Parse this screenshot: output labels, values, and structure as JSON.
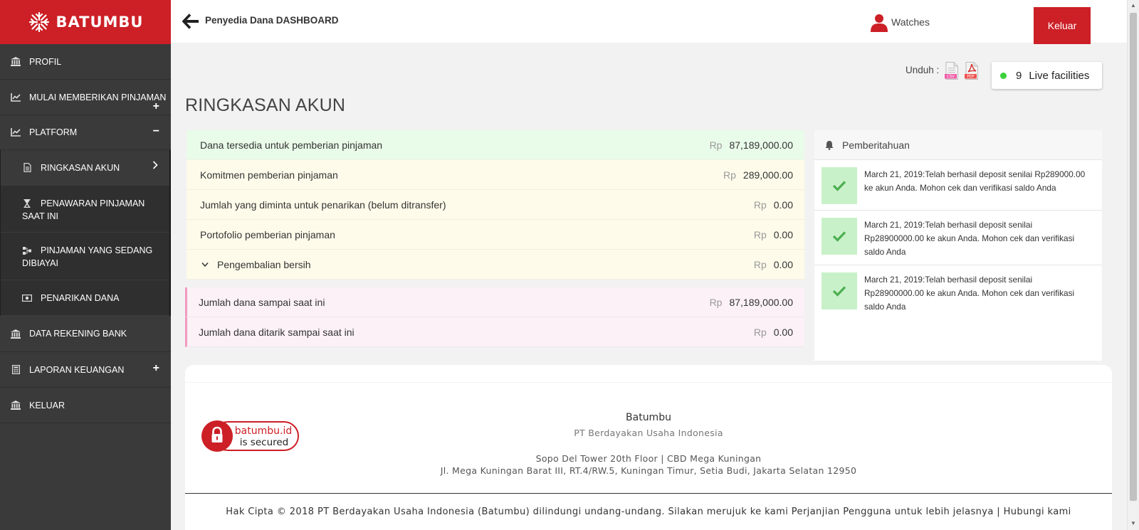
{
  "brand": {
    "name": "BATUMBU"
  },
  "sidebar": {
    "items": [
      {
        "label": "PROFIL",
        "icon": "bank-icon"
      },
      {
        "label": "MULAI MEMBERIKAN PINJAMAN",
        "icon": "chart-line-icon",
        "control": "+"
      },
      {
        "label": "PLATFORM",
        "icon": "chart-line-icon",
        "control": "−"
      },
      {
        "label": "DATA REKENING BANK",
        "icon": "bank-icon"
      },
      {
        "label": "LAPORAN KEUANGAN",
        "icon": "calculator-icon",
        "control": "+"
      },
      {
        "label": "KELUAR",
        "icon": "bank-icon"
      }
    ],
    "platform_sub": [
      {
        "label": "RINGKASAN AKUN",
        "icon": "document-icon",
        "active": true
      },
      {
        "label": "PENAWARAN PINJAMAN SAAT INI",
        "icon": "hourglass-icon"
      },
      {
        "label": "PINJAMAN YANG SEDANG DIBIAYAI",
        "icon": "sitemap-icon"
      },
      {
        "label": "PENARIKAN DANA",
        "icon": "money-icon"
      }
    ]
  },
  "header": {
    "title": "Penyedia Dana DASHBOARD",
    "user": "Watches",
    "logout_label": "Keluar"
  },
  "toolbar": {
    "download_label": "Unduh :",
    "csv_label": "CSV",
    "pdf_label": "PDF",
    "live_count": "9",
    "live_label": "Live facilities",
    "live_color": "#3ad13a"
  },
  "main": {
    "heading": "RINGKASAN AKUN",
    "currency": "Rp",
    "rows": [
      {
        "label": "Dana tersedia untuk pemberian pinjaman",
        "value": "87,189,000.00"
      },
      {
        "label": "Komitmen pemberian pinjaman",
        "value": "289,000.00"
      },
      {
        "label": "Jumlah yang diminta untuk penarikan (belum ditransfer)",
        "value": "0.00"
      },
      {
        "label": "Portofolio pemberian pinjaman",
        "value": "0.00"
      },
      {
        "label": "Pengembalian bersih",
        "value": "0.00"
      },
      {
        "label": "Jumlah dana sampai saat ini",
        "value": "87,189,000.00"
      },
      {
        "label": "Jumlah dana ditarik sampai saat ini",
        "value": "0.00"
      }
    ]
  },
  "notifications": {
    "title": "Pemberitahuan",
    "items": [
      {
        "text": "March 21, 2019:Telah berhasil deposit senilai Rp289000.00 ke akun Anda. Mohon cek dan verifikasi saldo Anda"
      },
      {
        "text": "March 21, 2019:Telah berhasil deposit senilai Rp28900000.00 ke akun Anda. Mohon cek dan verifikasi saldo Anda"
      },
      {
        "text": "March 21, 2019:Telah berhasil deposit senilai Rp28900000.00 ke akun Anda. Mohon cek dan verifikasi saldo Anda"
      }
    ]
  },
  "footer": {
    "badge_domain": "batumbu.id",
    "badge_status": "is secured",
    "company": "Batumbu",
    "legal_name": "PT Berdayakan Usaha Indonesia",
    "address_line1": "Sopo Del Tower 20th Floor | CBD Mega Kuningan",
    "address_line2": "Jl. Mega Kuningan Barat III, RT.4/RW.5, Kuningan Timur, Setia Budi, Jakarta Selatan 12950",
    "copyright_prefix": "Hak Cipta © 2018 PT Berdayakan Usaha Indonesia (Batumbu) dilindungi undang-undang. Silakan merujuk ke kami ",
    "agreement_link": "Perjanjian Pengguna",
    "copyright_suffix": " untuk lebih jelasnya",
    "separator": " | ",
    "contact_link": "Hubungi kami"
  },
  "colors": {
    "brand": "#cc1f26",
    "sidebar": "#3a3a3a",
    "success": "#c9f1c9",
    "check": "#4caf50"
  }
}
